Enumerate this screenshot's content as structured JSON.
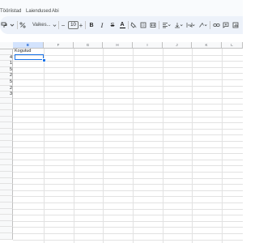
{
  "menu": {
    "items": [
      "Tööriistad",
      "Laiendused",
      "Abi"
    ]
  },
  "toolbar": {
    "font_name": "Vaikes...",
    "font_size": "10",
    "bold": "B",
    "italic": "I",
    "strikethrough": "S",
    "text_color": "A"
  },
  "sheet": {
    "column_headers": [
      "E",
      "F",
      "G",
      "H",
      "I",
      "J",
      "K",
      "L"
    ],
    "selected_column": "E",
    "header_cell": "Kogutud",
    "values": [
      "4",
      "1",
      "5",
      "2",
      "5",
      "2",
      "3"
    ]
  },
  "colors": {
    "accent": "#1a73e8",
    "toolbar_bg": "#edf2fa",
    "grid_line": "#e2e2e2"
  }
}
